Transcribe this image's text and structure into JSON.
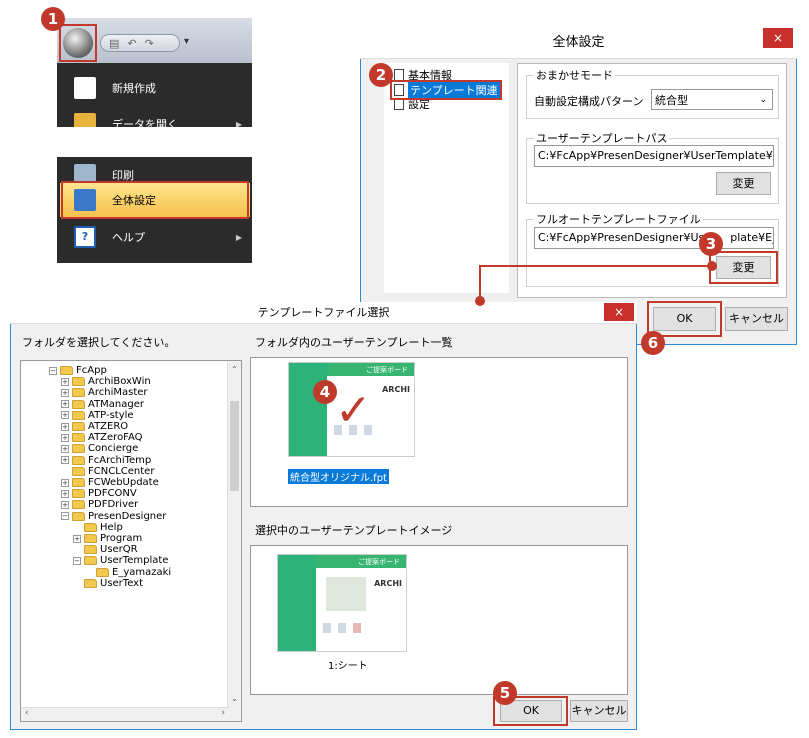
{
  "office_menu": {
    "items": [
      {
        "label": "新規作成",
        "icon": "new-document-icon"
      },
      {
        "label": "データを開く",
        "icon": "open-folder-icon",
        "has_arrow": true
      },
      {
        "label": "印刷",
        "icon": "printer-icon"
      },
      {
        "label": "全体設定",
        "icon": "settings-icon",
        "selected": true
      },
      {
        "label": "ヘルプ",
        "icon": "help-icon",
        "has_arrow": true
      }
    ]
  },
  "settings_dialog": {
    "title": "全体設定",
    "close": "×",
    "tree": [
      "基本情報",
      "テンプレート関連",
      "設定"
    ],
    "auto_mode": {
      "group_label": "おまかせモード",
      "pattern_label": "自動設定構成パターン",
      "pattern_value": "統合型"
    },
    "user_template_path": {
      "group_label": "ユーザーテンプレートパス",
      "value": "C:¥FcApp¥PresenDesigner¥UserTemplate¥E_",
      "change_button": "変更"
    },
    "full_auto_template": {
      "group_label": "フルオートテンプレートファイル",
      "value": "C:¥FcApp¥PresenDesigner¥Us",
      "value_tail": "plate¥E_",
      "change_button": "変更"
    },
    "ok_button": "OK",
    "cancel_button": "キャンセル"
  },
  "template_dialog": {
    "title": "テンプレートファイル選択",
    "close": "×",
    "folder_prompt": "フォルダを選択してください。",
    "list_label": "フォルダ内のユーザーテンプレート一覧",
    "preview_label": "選択中のユーザーテンプレートイメージ",
    "folders": [
      {
        "label": "FcApp",
        "level": 0,
        "toggle": "−"
      },
      {
        "label": "ArchiBoxWin",
        "level": 1,
        "toggle": "+"
      },
      {
        "label": "ArchiMaster",
        "level": 1,
        "toggle": "+"
      },
      {
        "label": "ATManager",
        "level": 1,
        "toggle": "+"
      },
      {
        "label": "ATP-style",
        "level": 1,
        "toggle": "+"
      },
      {
        "label": "ATZERO",
        "level": 1,
        "toggle": "+"
      },
      {
        "label": "ATZeroFAQ",
        "level": 1,
        "toggle": "+"
      },
      {
        "label": "Concierge",
        "level": 1,
        "toggle": "+"
      },
      {
        "label": "FcArchiTemp",
        "level": 1,
        "toggle": "+"
      },
      {
        "label": "FCNCLCenter",
        "level": 1,
        "toggle": ""
      },
      {
        "label": "FCWebUpdate",
        "level": 1,
        "toggle": "+"
      },
      {
        "label": "PDFCONV",
        "level": 1,
        "toggle": "+"
      },
      {
        "label": "PDFDriver",
        "level": 1,
        "toggle": "+"
      },
      {
        "label": "PresenDesigner",
        "level": 1,
        "toggle": "−"
      },
      {
        "label": "Help",
        "level": 2,
        "toggle": ""
      },
      {
        "label": "Program",
        "level": 2,
        "toggle": "+"
      },
      {
        "label": "UserQR",
        "level": 2,
        "toggle": ""
      },
      {
        "label": "UserTemplate",
        "level": 2,
        "toggle": "−"
      },
      {
        "label": "E_yamazaki",
        "level": 3,
        "toggle": ""
      },
      {
        "label": "UserText",
        "level": 2,
        "toggle": ""
      }
    ],
    "template_file": "統合型オリジナル.fpt",
    "preview_caption": "1:シート",
    "thumb_text": {
      "brand": "ARCHI",
      "header": "ご提案ボード"
    },
    "ok_button": "OK",
    "cancel_button": "キャンセル"
  },
  "callouts": [
    "1",
    "2",
    "3",
    "4",
    "5",
    "6"
  ],
  "colors": {
    "accent_red": "#c0392b",
    "selection_blue": "#0a7ad8",
    "close_red": "#c9302c"
  }
}
